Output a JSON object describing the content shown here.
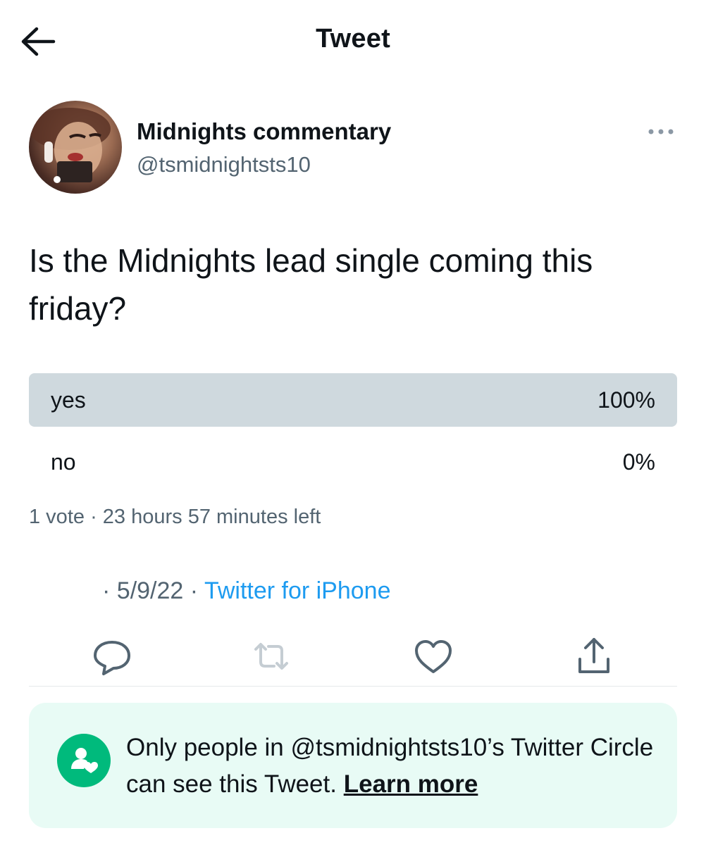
{
  "header": {
    "title": "Tweet",
    "back_icon": "arrow-left-icon"
  },
  "author": {
    "display_name": "Midnights commentary",
    "handle": "@tsmidnightsts10",
    "more_icon": "more-horizontal-icon"
  },
  "tweet": {
    "text": "Is the Midnights lead single coming this friday?",
    "date": "5/9/22",
    "source": "Twitter for iPhone",
    "dot": "·"
  },
  "poll": {
    "options": [
      {
        "label": "yes",
        "percent_text": "100%",
        "percent": 100,
        "leading": true
      },
      {
        "label": "no",
        "percent_text": "0%",
        "percent": 0,
        "leading": false
      }
    ],
    "votes": "1 vote",
    "time_left": "23 hours 57 minutes left",
    "dot": "·"
  },
  "actions": [
    {
      "name": "reply",
      "icon": "reply-icon"
    },
    {
      "name": "retweet",
      "icon": "retweet-icon",
      "disabled": true
    },
    {
      "name": "like",
      "icon": "heart-icon"
    },
    {
      "name": "share",
      "icon": "share-icon"
    }
  ],
  "circle_notice": {
    "text": "Only people in @tsmidnightsts10’s Twitter Circle can see this Tweet.",
    "link": "Learn more",
    "icon": "twitter-circle-icon"
  },
  "colors": {
    "text_primary": "#0f1419",
    "text_secondary": "#536471",
    "link": "#1d9bf0",
    "poll_leading_fill": "#cfd9de",
    "circle_green": "#00ba7c",
    "circle_bg": "#e8fbf5",
    "retweet_disabled": "#c5cdd3"
  }
}
